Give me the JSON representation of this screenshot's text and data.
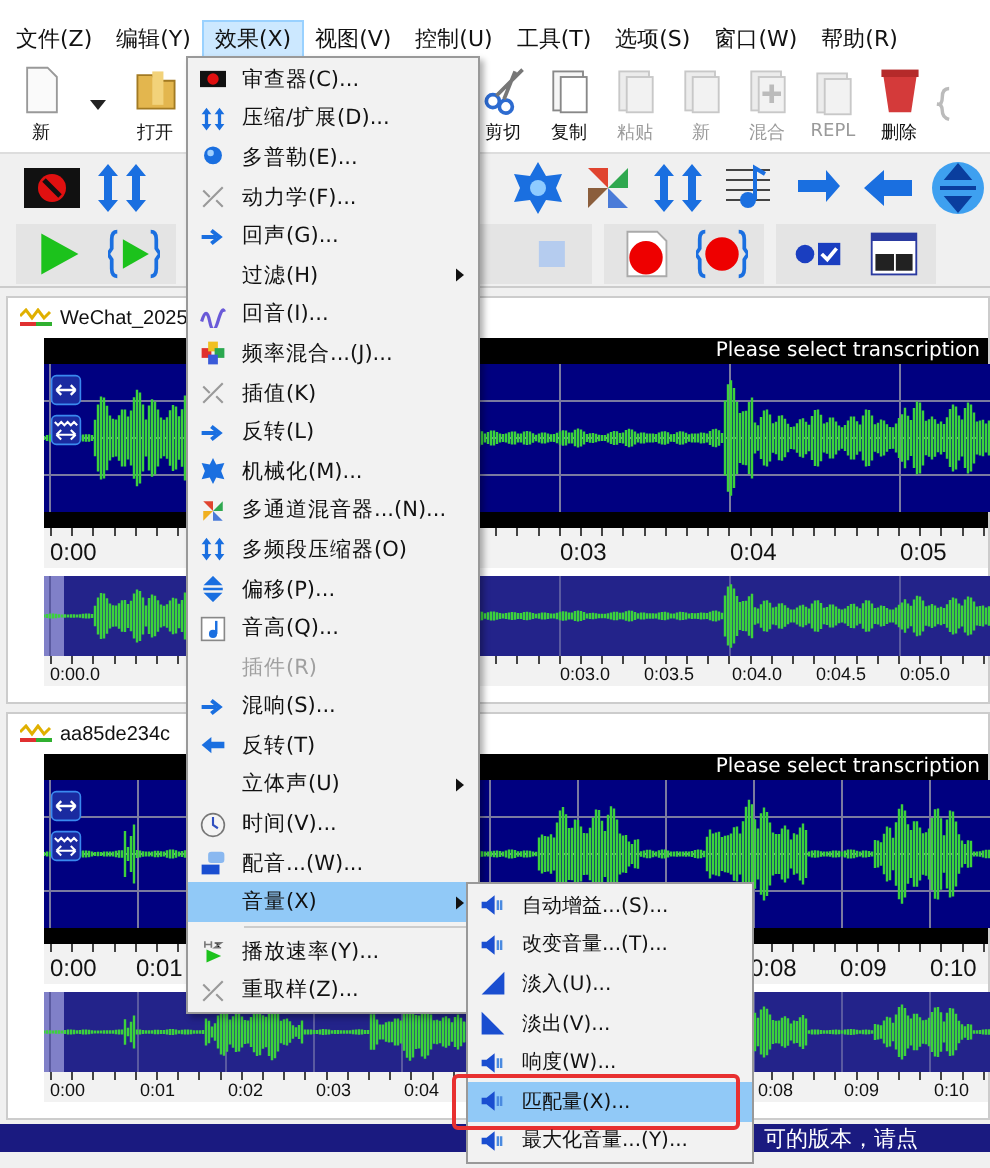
{
  "menubar": [
    {
      "label": "文件(Z)",
      "selected": false
    },
    {
      "label": "编辑(Y)",
      "selected": false
    },
    {
      "label": "效果(X)",
      "selected": true
    },
    {
      "label": "视图(V)",
      "selected": false
    },
    {
      "label": "控制(U)",
      "selected": false
    },
    {
      "label": "工具(T)",
      "selected": false
    },
    {
      "label": "选项(S)",
      "selected": false
    },
    {
      "label": "窗口(W)",
      "selected": false
    },
    {
      "label": "帮助(R)",
      "selected": false
    }
  ],
  "toolbar_left": [
    {
      "label": "新",
      "disabled": false
    },
    {
      "label": "打开",
      "disabled": false
    }
  ],
  "toolbar_right": [
    {
      "label": "剪切",
      "disabled": false
    },
    {
      "label": "复制",
      "disabled": false
    },
    {
      "label": "粘贴",
      "disabled": true
    },
    {
      "label": "新",
      "disabled": true
    },
    {
      "label": "混合",
      "disabled": true
    },
    {
      "label": "REPL",
      "disabled": true
    },
    {
      "label": "删除",
      "disabled": false
    }
  ],
  "tracks": [
    {
      "title": "WeChat_2025",
      "banner": "Please select transcription",
      "ruler": [
        "0:00",
        "0:03",
        "0:04",
        "0:05"
      ],
      "overview_ruler": [
        "0:00.0",
        "0:03.0",
        "0:03.5",
        "0:04.0",
        "0:04.5",
        "0:05.0"
      ]
    },
    {
      "title": "aa85de234c",
      "banner": "Please select transcription",
      "ruler": [
        "0:00",
        "0:01",
        "0:08",
        "0:09",
        "0:10"
      ],
      "overview_ruler": [
        "0:00",
        "0:01",
        "0:02",
        "0:03",
        "0:04",
        "0:08",
        "0:09",
        "0:10"
      ]
    }
  ],
  "effects_menu": [
    {
      "label": "审查器(C)...",
      "has_submenu": false,
      "disabled": false,
      "selected": false
    },
    {
      "label": "压缩/扩展(D)...",
      "has_submenu": false,
      "disabled": false,
      "selected": false
    },
    {
      "label": "多普勒(E)...",
      "has_submenu": false,
      "disabled": false,
      "selected": false
    },
    {
      "label": "动力学(F)...",
      "has_submenu": false,
      "disabled": false,
      "selected": false
    },
    {
      "label": "回声(G)...",
      "has_submenu": false,
      "disabled": false,
      "selected": false
    },
    {
      "label": "过滤(H)",
      "has_submenu": true,
      "disabled": false,
      "selected": false
    },
    {
      "label": "回音(I)...",
      "has_submenu": false,
      "disabled": false,
      "selected": false
    },
    {
      "label": "频率混合...(J)...",
      "has_submenu": false,
      "disabled": false,
      "selected": false
    },
    {
      "label": "插值(K)",
      "has_submenu": false,
      "disabled": false,
      "selected": false
    },
    {
      "label": "反转(L)",
      "has_submenu": false,
      "disabled": false,
      "selected": false
    },
    {
      "label": "机械化(M)...",
      "has_submenu": false,
      "disabled": false,
      "selected": false
    },
    {
      "label": "多通道混音器...(N)...",
      "has_submenu": false,
      "disabled": false,
      "selected": false
    },
    {
      "label": "多频段压缩器(O)",
      "has_submenu": false,
      "disabled": false,
      "selected": false
    },
    {
      "label": "偏移(P)...",
      "has_submenu": false,
      "disabled": false,
      "selected": false
    },
    {
      "label": "音高(Q)...",
      "has_submenu": false,
      "disabled": false,
      "selected": false
    },
    {
      "label": "插件(R)",
      "has_submenu": false,
      "disabled": true,
      "selected": false
    },
    {
      "label": "混响(S)...",
      "has_submenu": false,
      "disabled": false,
      "selected": false
    },
    {
      "label": "反转(T)",
      "has_submenu": false,
      "disabled": false,
      "selected": false
    },
    {
      "label": "立体声(U)",
      "has_submenu": true,
      "disabled": false,
      "selected": false
    },
    {
      "label": "时间(V)...",
      "has_submenu": false,
      "disabled": false,
      "selected": false
    },
    {
      "label": "配音...(W)...",
      "has_submenu": false,
      "disabled": false,
      "selected": false
    },
    {
      "label": "音量(X)",
      "has_submenu": true,
      "disabled": false,
      "selected": true
    },
    {
      "label": "播放速率(Y)...",
      "has_submenu": false,
      "disabled": false,
      "selected": false
    },
    {
      "label": "重取样(Z)...",
      "has_submenu": false,
      "disabled": false,
      "selected": false
    }
  ],
  "volume_submenu": [
    {
      "label": "自动增益...(S)...",
      "selected": false,
      "highlighted": false
    },
    {
      "label": "改变音量...(T)...",
      "selected": false,
      "highlighted": false
    },
    {
      "label": "淡入(U)...",
      "selected": false,
      "highlighted": false
    },
    {
      "label": "淡出(V)...",
      "selected": false,
      "highlighted": false
    },
    {
      "label": "响度(W)...",
      "selected": false,
      "highlighted": false
    },
    {
      "label": "匹配量(X)...",
      "selected": true,
      "highlighted": true
    },
    {
      "label": "最大化音量...(Y)...",
      "selected": false,
      "highlighted": false
    }
  ],
  "status_bar": "可的版本，请点"
}
